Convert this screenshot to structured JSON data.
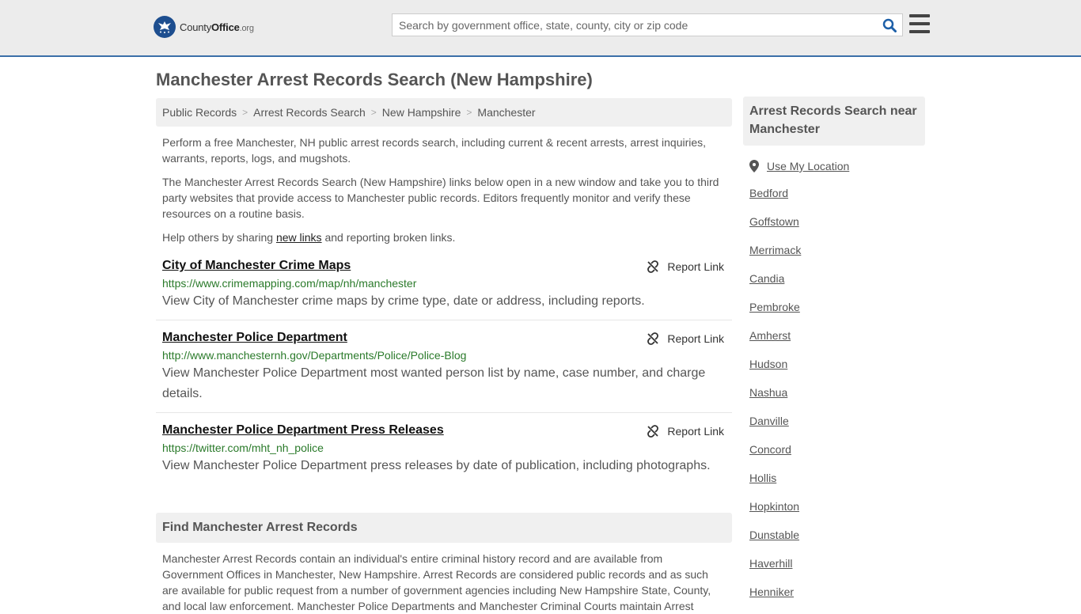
{
  "header": {
    "logo_main": "County",
    "logo_bold": "Office",
    "logo_org": ".org",
    "search_placeholder": "Search by government office, state, county, city or zip code",
    "search_icon": "search-icon",
    "menu_icon": "hamburger-menu-icon"
  },
  "page": {
    "title": "Manchester Arrest Records Search (New Hampshire)"
  },
  "breadcrumb": [
    "Public Records",
    "Arrest Records Search",
    "New Hampshire",
    "Manchester"
  ],
  "intro": {
    "p1": "Perform a free Manchester, NH public arrest records search, including current & recent arrests, arrest inquiries, warrants, reports, logs, and mugshots.",
    "p2": "The Manchester Arrest Records Search (New Hampshire) links below open in a new window and take you to third party websites that provide access to Manchester public records. Editors frequently monitor and verify these resources on a routine basis.",
    "p3_before": "Help others by sharing ",
    "p3_link": "new links",
    "p3_after": " and reporting broken links."
  },
  "links": [
    {
      "title": "City of Manchester Crime Maps",
      "url": "https://www.crimemapping.com/map/nh/manchester",
      "description": "View City of Manchester crime maps by crime type, date or address, including reports.",
      "report_label": "Report Link"
    },
    {
      "title": "Manchester Police Department",
      "url": "http://www.manchesternh.gov/Departments/Police/Police-Blog",
      "description": "View Manchester Police Department most wanted person list by name, case number, and charge details.",
      "report_label": "Report Link"
    },
    {
      "title": "Manchester Police Department Press Releases",
      "url": "https://twitter.com/mht_nh_police",
      "description": "View Manchester Police Department press releases by date of publication, including photographs.",
      "report_label": "Report Link"
    }
  ],
  "find": {
    "heading": "Find Manchester Arrest Records",
    "body": "Manchester Arrest Records contain an individual's entire criminal history record and are available from Government Offices in Manchester, New Hampshire. Arrest Records are considered public records and as such are available for public request from a number of government agencies including New Hampshire State, County, and local law enforcement. Manchester Police Departments and Manchester Criminal Courts maintain Arrest"
  },
  "sidebar": {
    "heading": "Arrest Records Search near Manchester",
    "use_location": "Use My Location",
    "cities": [
      "Bedford",
      "Goffstown",
      "Merrimack",
      "Candia",
      "Pembroke",
      "Amherst",
      "Hudson",
      "Nashua",
      "Danville",
      "Concord",
      "Hollis",
      "Hopkinton",
      "Dunstable",
      "Haverhill",
      "Henniker"
    ]
  },
  "colors": {
    "header_bg": "#ececec",
    "header_border": "#3b6fa8",
    "url_green": "#2a7a2a",
    "search_icon": "#1d5fa8"
  }
}
